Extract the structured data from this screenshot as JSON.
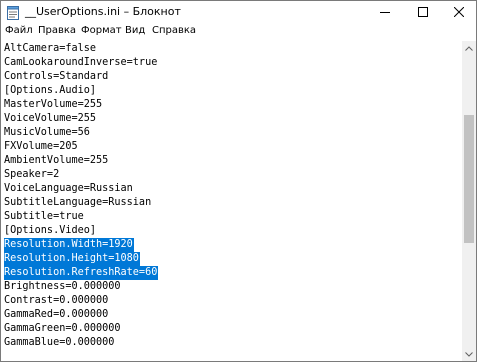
{
  "window": {
    "title": "__UserOptions.ini – Блокнот"
  },
  "menu": [
    "Файл",
    "Правка",
    "Формат",
    "Вид",
    "Справка"
  ],
  "lines": [
    "AltCamera=false",
    "CamLookaroundInverse=true",
    "Controls=Standard",
    "[Options.Audio]",
    "MasterVolume=255",
    "VoiceVolume=255",
    "MusicVolume=56",
    "FXVolume=205",
    "AmbientVolume=255",
    "Speaker=2",
    "VoiceLanguage=Russian",
    "SubtitleLanguage=Russian",
    "Subtitle=true",
    "[Options.Video]",
    "Resolution.Width=1920",
    "Resolution.Height=1080",
    "Resolution.RefreshRate=60",
    "Brightness=0.000000",
    "Contrast=0.000000",
    "GammaRed=0.000000",
    "GammaGreen=0.000000",
    "GammaBlue=0.000000"
  ],
  "selected_lines": [
    14,
    15,
    16
  ],
  "colors": {
    "selection": "#0078d7",
    "scrollbar_track": "#f0f0f0",
    "scrollbar_thumb": "#c2c2c2"
  }
}
